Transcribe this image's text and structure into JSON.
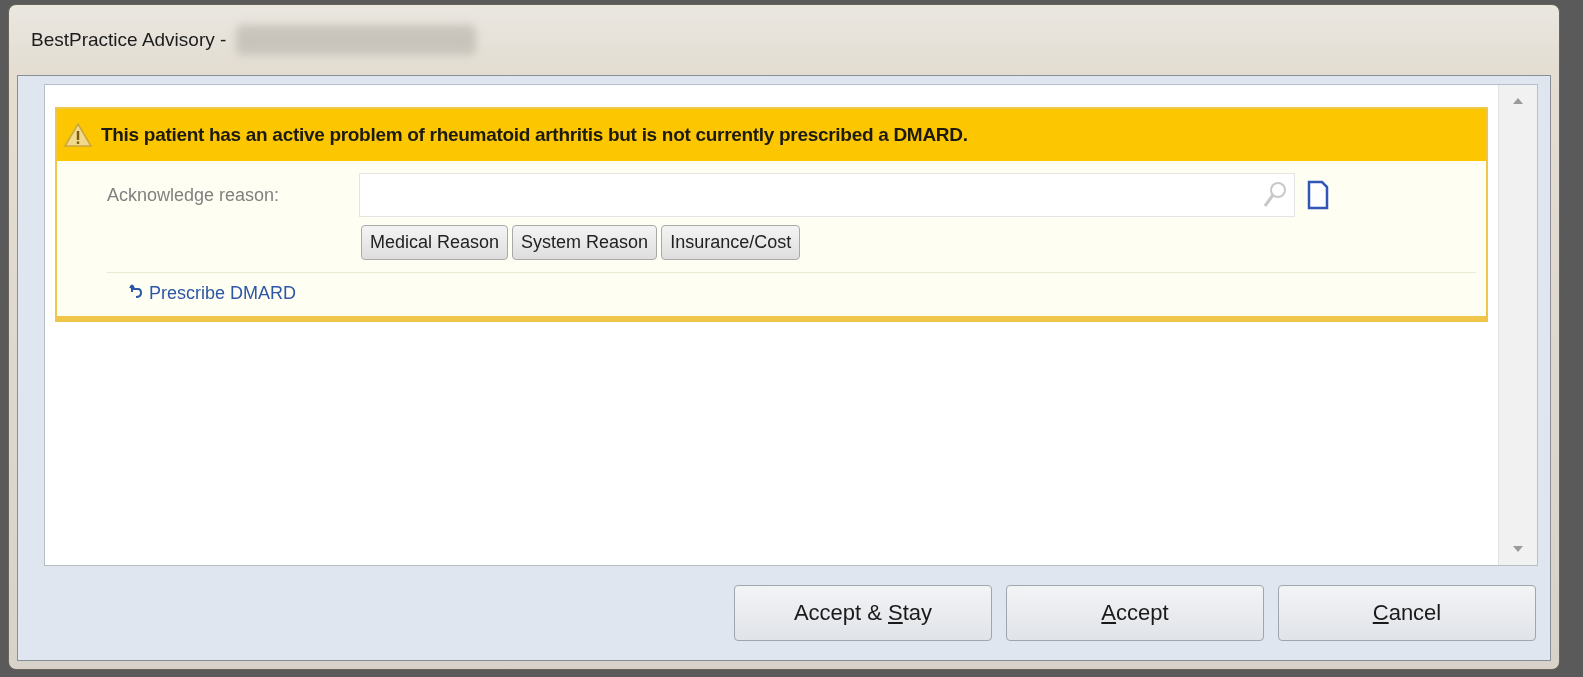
{
  "window": {
    "title": "BestPractice Advisory -"
  },
  "advisory": {
    "message": "This patient has an active problem of rheumatoid arthritis but is not currently prescribed a DMARD.",
    "reason_label": "Acknowledge reason:",
    "reasons": [
      "Medical Reason",
      "System Reason",
      "Insurance/Cost"
    ],
    "action_link": "Prescribe DMARD"
  },
  "buttons": [
    {
      "before": "Accept & ",
      "key": "S",
      "after": "tay"
    },
    {
      "key": "A",
      "after": "ccept"
    },
    {
      "key": "C",
      "after": "ancel"
    }
  ]
}
